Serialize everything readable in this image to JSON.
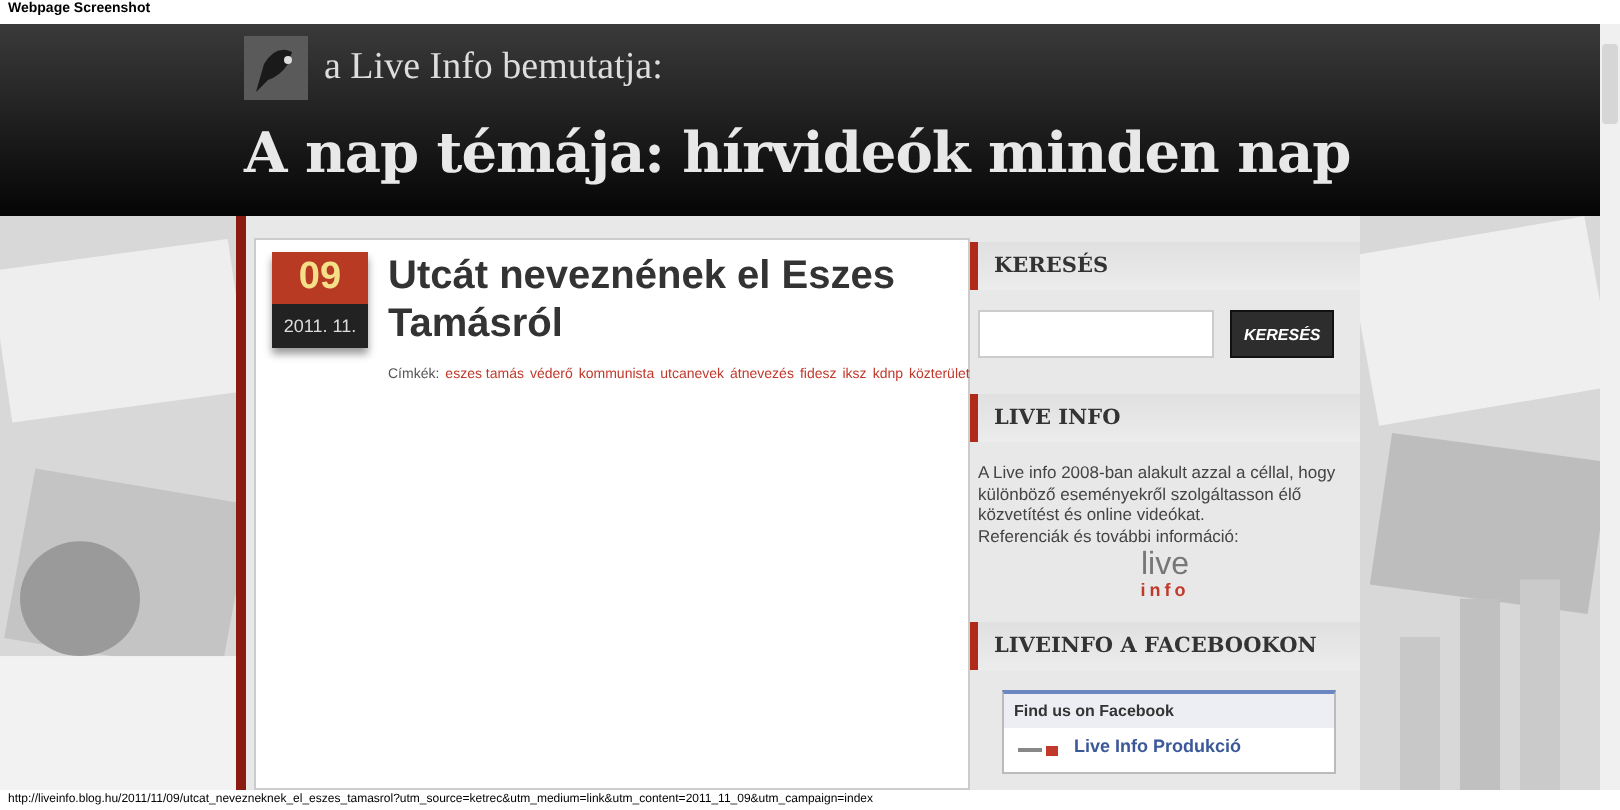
{
  "caption": "Webpage Screenshot",
  "header": {
    "subtitle": "a Live Info bemutatja:",
    "title": "A nap témája: hírvideók minden nap"
  },
  "post": {
    "day": "09",
    "month": "2011. 11.",
    "title": "Utcát neveznének el Eszes Tamásról",
    "tags_label": "Címkék:",
    "tags": [
      "eszes tamás",
      "véderő",
      "kommunista",
      "utcanevek",
      "átnevezés",
      "fidesz",
      "iksz",
      "kdnp",
      "közterület"
    ]
  },
  "sidebar": {
    "search": {
      "heading": "KERESÉS",
      "button": "KERESÉS"
    },
    "about": {
      "heading": "LIVE INFO",
      "text": "A Live info 2008-ban alakult azzal a céllal, hogy különböző eseményekről szolgáltasson élő közvetítést és online videókat.",
      "link": "Referenciák és további információ:",
      "logo_top": "live",
      "logo_bottom": "info"
    },
    "facebook": {
      "heading": "LIVEINFO A FACEBOOKON",
      "box_title": "Find us on Facebook",
      "page_name": "Live Info Produkció"
    }
  },
  "status_bar": "http://liveinfo.blog.hu/2011/11/09/utcat_nevezneknek_el_eszes_tamasrol?utm_source=ketrec&utm_medium=link&utm_content=2011_11_09&utm_campaign=index"
}
